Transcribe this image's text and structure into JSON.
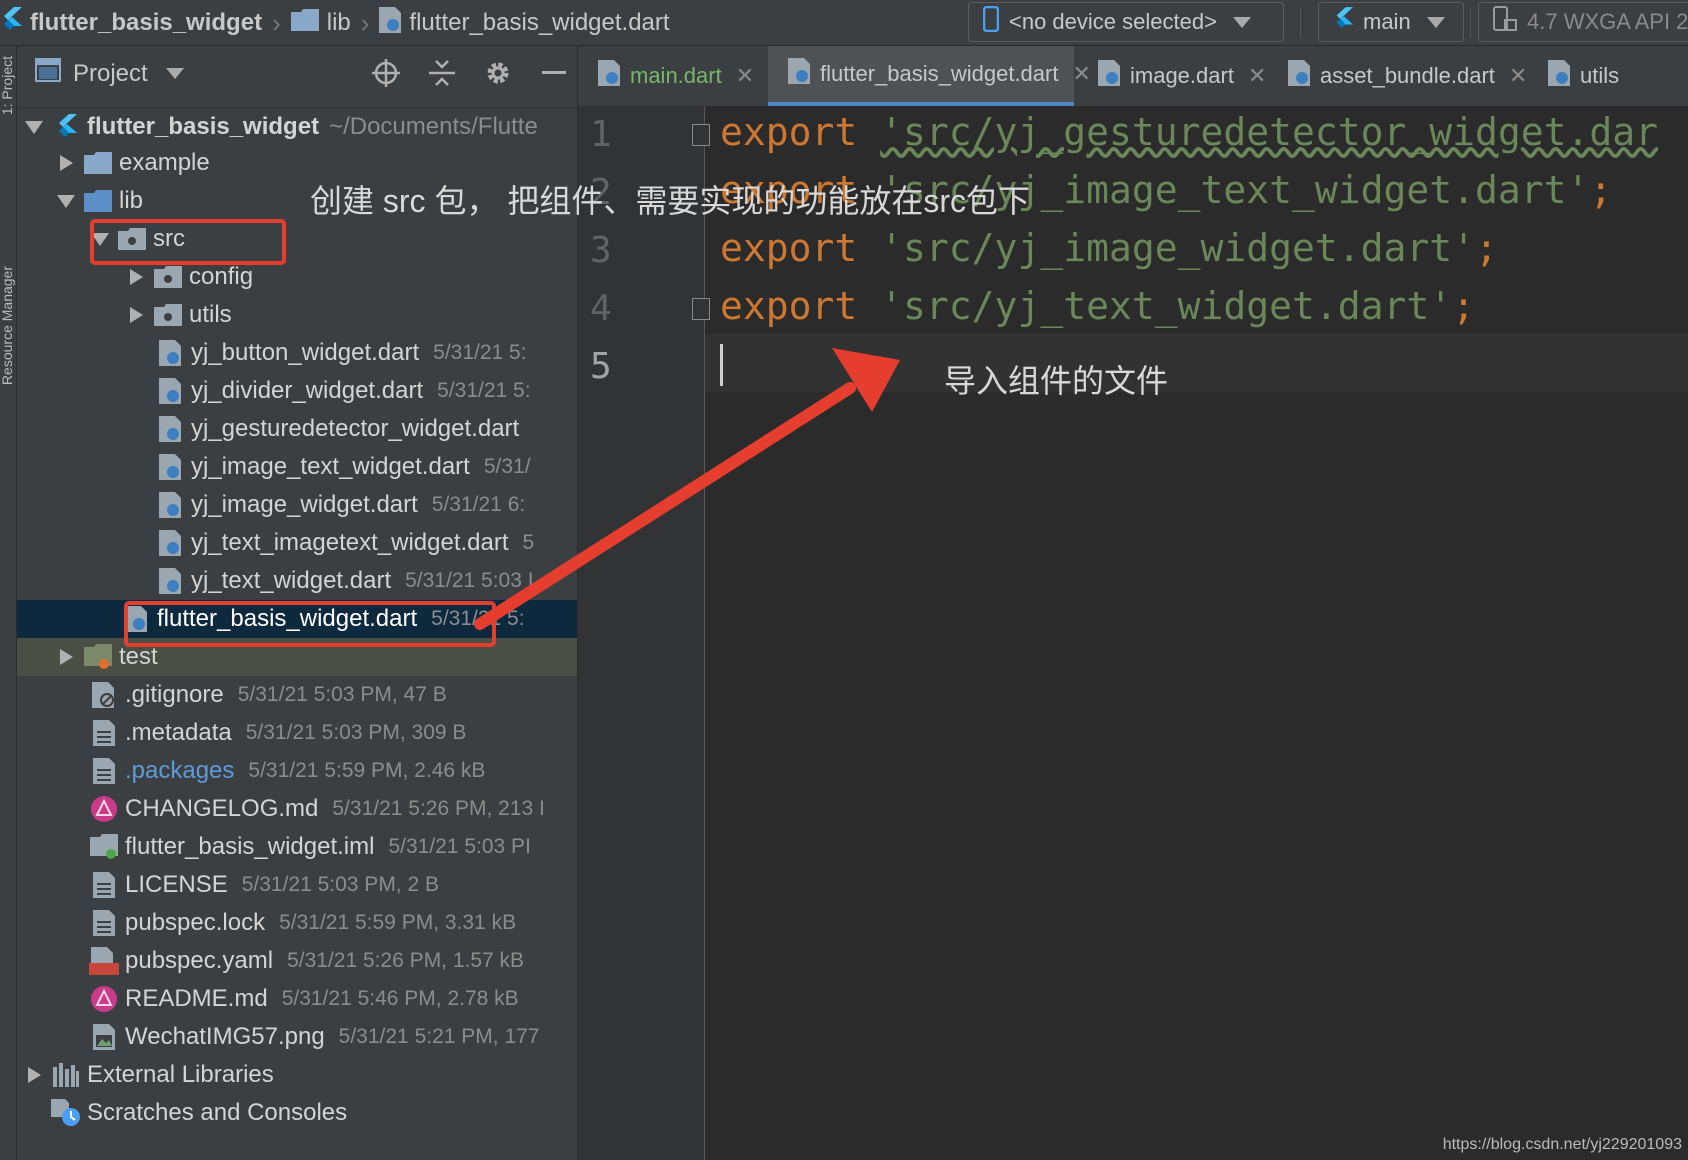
{
  "breadcrumb": {
    "project": "flutter_basis_widget",
    "folder": "lib",
    "file": "flutter_basis_widget.dart"
  },
  "toolbar": {
    "device": "<no device selected>",
    "config": "main",
    "emulator": "4.7  WXGA API 2"
  },
  "stripe": {
    "project_tab": "1: Project",
    "resource_tab": "Resource Manager"
  },
  "panel": {
    "title": "Project"
  },
  "tree": {
    "root": {
      "name": "flutter_basis_widget",
      "path": "~/Documents/Flutte"
    },
    "items": [
      {
        "name": "example",
        "meta": ""
      },
      {
        "name": "lib",
        "meta": ""
      },
      {
        "name": "src",
        "meta": ""
      },
      {
        "name": "config",
        "meta": ""
      },
      {
        "name": "utils",
        "meta": ""
      },
      {
        "name": "yj_button_widget.dart",
        "meta": "5/31/21 5:"
      },
      {
        "name": "yj_divider_widget.dart",
        "meta": "5/31/21 5:"
      },
      {
        "name": "yj_gesturedetector_widget.dart",
        "meta": ""
      },
      {
        "name": "yj_image_text_widget.dart",
        "meta": "5/31/"
      },
      {
        "name": "yj_image_widget.dart",
        "meta": "5/31/21 6:"
      },
      {
        "name": "yj_text_imagetext_widget.dart",
        "meta": "5"
      },
      {
        "name": "yj_text_widget.dart",
        "meta": "5/31/21 5:03 I"
      },
      {
        "name": "flutter_basis_widget.dart",
        "meta": "5/31/21 5:"
      },
      {
        "name": "test",
        "meta": ""
      },
      {
        "name": ".gitignore",
        "meta": "5/31/21 5:03 PM, 47 B"
      },
      {
        "name": ".metadata",
        "meta": "5/31/21 5:03 PM, 309 B"
      },
      {
        "name": ".packages",
        "meta": "5/31/21 5:59 PM, 2.46 kB"
      },
      {
        "name": "CHANGELOG.md",
        "meta": "5/31/21 5:26 PM, 213 I"
      },
      {
        "name": "flutter_basis_widget.iml",
        "meta": "5/31/21 5:03 PI"
      },
      {
        "name": "LICENSE",
        "meta": "5/31/21 5:03 PM, 2 B"
      },
      {
        "name": "pubspec.lock",
        "meta": "5/31/21 5:59 PM, 3.31 kB"
      },
      {
        "name": "pubspec.yaml",
        "meta": "5/31/21 5:26 PM, 1.57 kB"
      },
      {
        "name": "README.md",
        "meta": "5/31/21 5:46 PM, 2.78 kB"
      },
      {
        "name": "WechatIMG57.png",
        "meta": "5/31/21 5:21 PM, 177"
      },
      {
        "name": "External Libraries",
        "meta": ""
      },
      {
        "name": "Scratches and Consoles",
        "meta": ""
      }
    ]
  },
  "tabs": [
    {
      "label": "main.dart"
    },
    {
      "label": "flutter_basis_widget.dart"
    },
    {
      "label": "image.dart"
    },
    {
      "label": "asset_bundle.dart"
    },
    {
      "label": "utils"
    }
  ],
  "editor": {
    "line_numbers": [
      "1",
      "2",
      "3",
      "4",
      "5"
    ],
    "lines": [
      {
        "keyword": "export",
        "string": "'src/yj_gesturedetector_widget.dar"
      },
      {
        "keyword": "export",
        "string": "'src/yj_image_text_widget.dart'",
        "end": ";"
      },
      {
        "keyword": "export",
        "string": "'src/yj_image_widget.dart'",
        "end": ";"
      },
      {
        "keyword": "export",
        "string": "'src/yj_text_widget.dart'",
        "end": ";"
      }
    ]
  },
  "annotations": {
    "src_note": "创建 src 包， 把组件、需要实现的功能放在src包下",
    "import_note": "导入组件的文件",
    "color": "#e53d2e"
  },
  "watermark": "https://blog.csdn.net/yj229201093"
}
